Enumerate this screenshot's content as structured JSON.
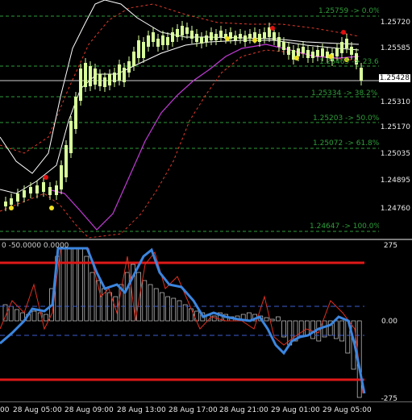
{
  "price_axis": {
    "labels": [
      "1.25720",
      "1.25585",
      "1.25310",
      "1.25170",
      "1.25035",
      "1.24895",
      "1.24760"
    ],
    "current_price": "1.25428"
  },
  "fib_levels": [
    {
      "label": "1.25759 -> 0.0%"
    },
    {
      "label": "1.25465 -> 23.6%"
    },
    {
      "label": "1.25334 -> 38.2%"
    },
    {
      "label": "1.25203 -> 50.0%"
    },
    {
      "label": "1.25072 -> 61.8%"
    },
    {
      "label": "1.24647 -> 100.0%"
    }
  ],
  "oscillator": {
    "header": "0 -50.0000 0.0000",
    "axis_labels": [
      "275",
      "0.00",
      "-275"
    ]
  },
  "time_axis": {
    "labels": [
      "00",
      "28 Aug 05:00",
      "28 Aug 09:00",
      "28 Aug 13:00",
      "28 Aug 17:00",
      "28 Aug 21:00",
      "29 Aug 01:00",
      "29 Aug 05:00"
    ]
  },
  "colors": {
    "background": "#000000",
    "bull_candle": "#d8ff9a",
    "bear_candle": "#d8ff9a",
    "band_outer": "#ffffff",
    "band_dotted": "#e23a2a",
    "ma_magenta": "#c23bd8",
    "fib": "#2e9e3a",
    "osc_line": "#3b86e0",
    "osc_signal": "#e03020",
    "osc_limit": "#e01818",
    "osc_dash": "#3b5fd0"
  }
}
